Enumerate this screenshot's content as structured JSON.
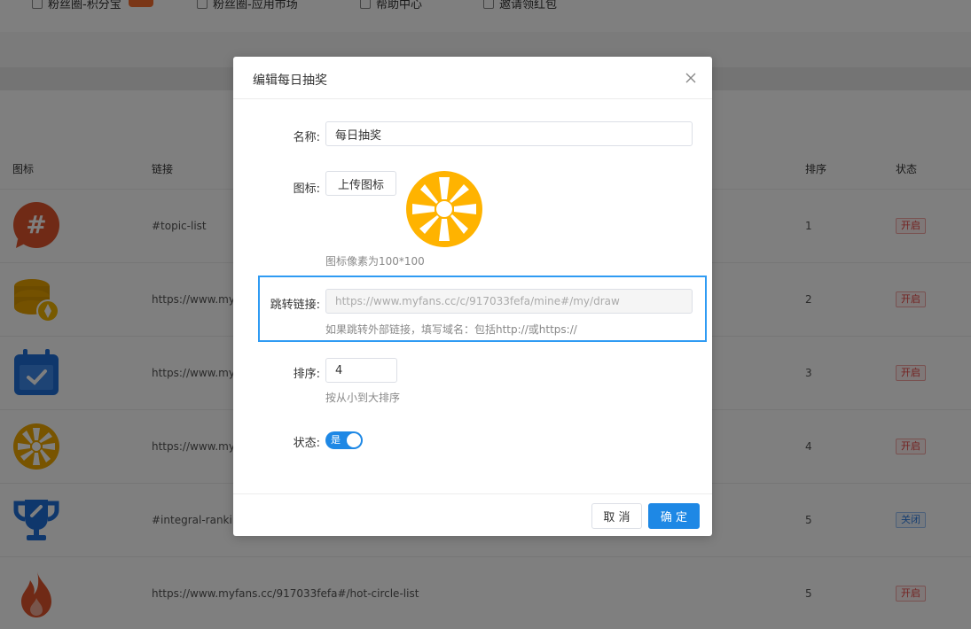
{
  "topnav": {
    "items": [
      {
        "label": "粉丝圈-积分宝"
      },
      {
        "label": "粉丝圈-应用市场"
      },
      {
        "label": "帮助中心"
      },
      {
        "label": "邀请领红包"
      }
    ]
  },
  "table": {
    "headers": {
      "icon": "图标",
      "link": "链接",
      "sort": "排序",
      "status": "状态"
    },
    "rows": [
      {
        "icon": "hashtag-chat-icon",
        "link": "#topic-list",
        "sort": "1",
        "status": "开启",
        "status_type": "on"
      },
      {
        "icon": "coins-icon",
        "link": "https://www.myf",
        "sort": "2",
        "status": "开启",
        "status_type": "on"
      },
      {
        "icon": "calendar-check-icon",
        "link": "https://www.myf",
        "sort": "3",
        "status": "开启",
        "status_type": "on"
      },
      {
        "icon": "lottery-wheel-icon",
        "link": "https://www.myf",
        "sort": "4",
        "status": "开启",
        "status_type": "on"
      },
      {
        "icon": "trophy-icon",
        "link": "#integral-ranking",
        "sort": "5",
        "status": "关闭",
        "status_type": "off"
      },
      {
        "icon": "flame-icon",
        "link": "https://www.myfans.cc/917033fefa#/hot-circle-list",
        "sort": "5",
        "status": "开启",
        "status_type": "on"
      }
    ]
  },
  "modal": {
    "title": "编辑每日抽奖",
    "name_label": "名称:",
    "name_value": "每日抽奖",
    "icon_label": "图标:",
    "upload_label": "上传图标",
    "icon_hint": "图标像素为100*100",
    "link_label": "跳转链接:",
    "link_value": "https://www.myfans.cc/c/917033fefa/mine#/my/draw",
    "link_hint": "如果跳转外部链接，填写域名：包括http://或https://",
    "sort_label": "排序:",
    "sort_value": "4",
    "sort_hint": "按从小到大排序",
    "status_label": "状态:",
    "status_switch_text": "是",
    "cancel_label": "取 消",
    "ok_label": "确 定"
  },
  "colors": {
    "primary": "#1e88e5",
    "highlight": "#2f9bf3",
    "wheel": "#ffb300",
    "status_on": "#e64340",
    "status_off": "#2f7ce0"
  }
}
